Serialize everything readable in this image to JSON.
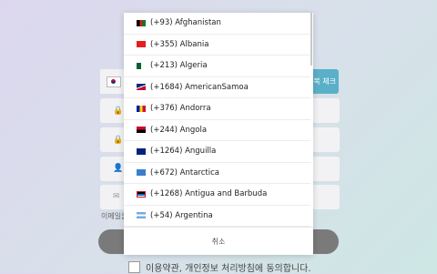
{
  "form": {
    "dup_check_label": "복 체크",
    "email_hint": "이메일을",
    "terms_label": "이용약관, 개인정보 처리방침에 동의합니다."
  },
  "country_picker": {
    "items": [
      {
        "label": "(+93) Afghanistan"
      },
      {
        "label": "(+355) Albania"
      },
      {
        "label": "(+213) Algeria"
      },
      {
        "label": "(+1684) AmericanSamoa"
      },
      {
        "label": "(+376) Andorra"
      },
      {
        "label": "(+244) Angola"
      },
      {
        "label": "(+1264) Anguilla"
      },
      {
        "label": "(+672) Antarctica"
      },
      {
        "label": "(+1268) Antigua and Barbuda"
      },
      {
        "label": "(+54) Argentina"
      }
    ],
    "cancel_label": "취소"
  },
  "colors": {
    "dup_button": "#5ab0c8",
    "submit_button": "#7a7a7a"
  }
}
